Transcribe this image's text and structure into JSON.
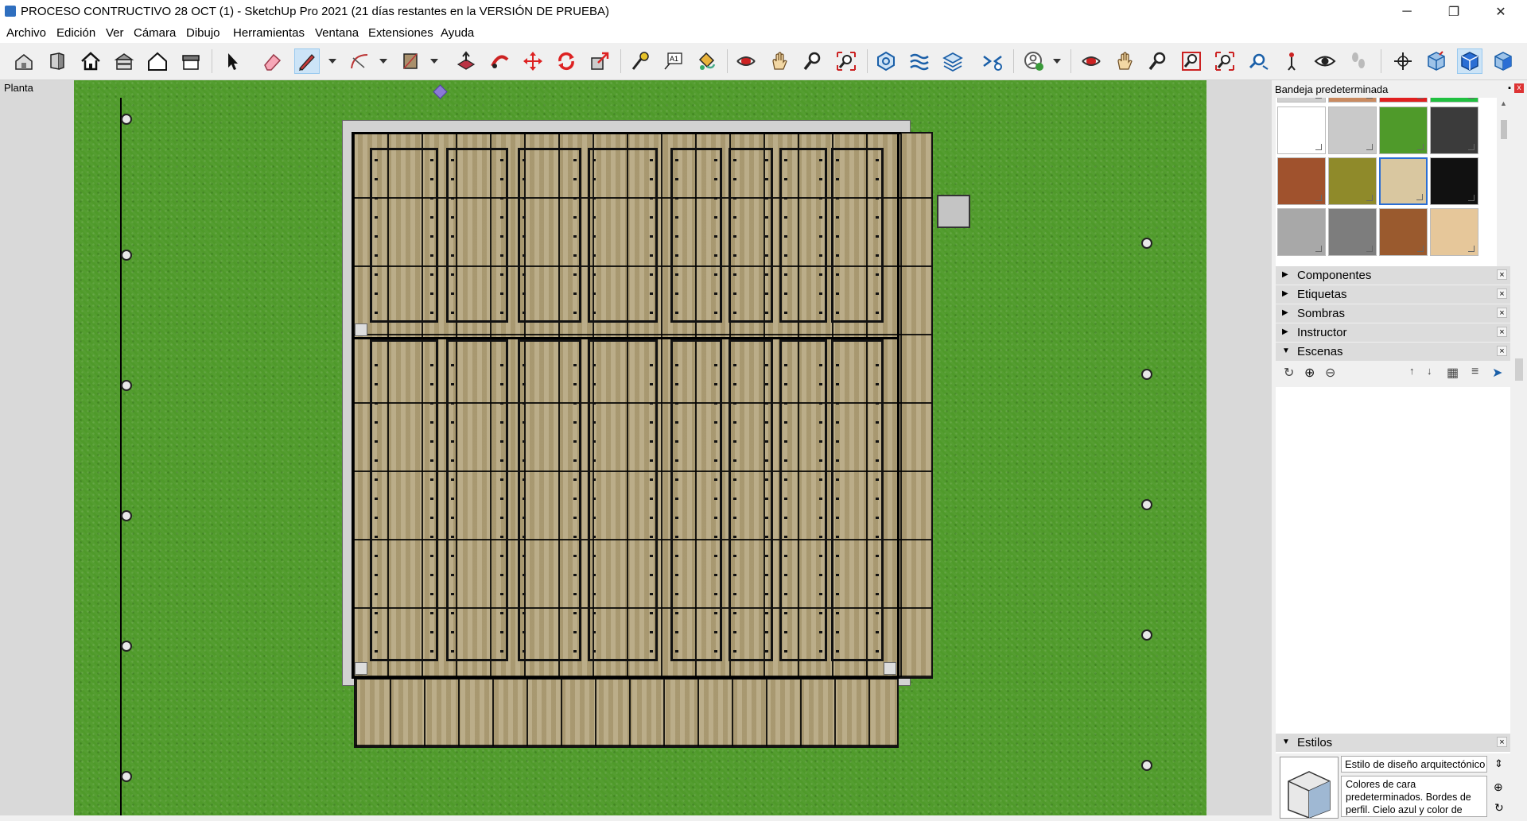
{
  "window": {
    "title": "PROCESO CONTRUCTIVO 28 OCT (1) - SketchUp Pro 2021 (21 días restantes en la VERSIÓN DE PRUEBA)",
    "minimize": "─",
    "maximize": "❐",
    "close": "✕"
  },
  "menu": [
    "Archivo",
    "Edición",
    "Ver",
    "Cámara",
    "Dibujo",
    "Herramientas",
    "Ventana",
    "Extensiones",
    "Ayuda"
  ],
  "toolbar": {
    "icons": [
      "house-iso-icon",
      "front-view-icon",
      "home-icon",
      "back-view-icon",
      "top-house-icon",
      "side-house-icon",
      "select-arrow-icon",
      "eraser-icon",
      "pencil-line-icon",
      "arc-icon",
      "rectangle-icon",
      "push-pull-icon",
      "follow-me-icon",
      "move-icon",
      "rotate-icon",
      "scale-icon",
      "tape-measure-icon",
      "text-icon",
      "paint-bucket-icon",
      "orbit-icon",
      "pan-icon",
      "zoom-icon",
      "zoom-extents-icon",
      "solid-tools-icon",
      "section-plane-icon",
      "layers-icon",
      "settings-icon",
      "user-account-icon",
      "orbit-2-icon",
      "pan-2-icon",
      "zoom-2-icon",
      "zoom-window-icon",
      "zoom-extents-2-icon",
      "previous-view-icon",
      "position-camera-icon",
      "look-around-icon",
      "walk-icon",
      "axes-icon",
      "iso-view-icon",
      "top-view-icon",
      "right-view-icon"
    ]
  },
  "viewport": {
    "scene_label": "Planta"
  },
  "tray": {
    "title": "Bandeja predeterminada",
    "pin": "▪",
    "close": "x",
    "swatch_colors": [
      "#ffffff",
      "#c9c9c9",
      "#4f9a2a",
      "#3b3b3b",
      "#a0522d",
      "#8f8a2a",
      "#d9c7a0",
      "#111111",
      "#a8a8a8",
      "#7d7d7d",
      "#9a5a2e",
      "#e6c79a"
    ],
    "selected_swatch": 6
  },
  "panels": {
    "componentes": "Componentes",
    "etiquetas": "Etiquetas",
    "sombras": "Sombras",
    "instructor": "Instructor",
    "escenas": "Escenas",
    "estilos": "Estilos"
  },
  "scenes_toolbar": {
    "refresh": "↻",
    "add": "⊕",
    "remove": "⊖",
    "move_up": "↑",
    "move_down": "↓",
    "view_options": "▦",
    "details": "≡",
    "next": "➤"
  },
  "styles": {
    "name": "Estilo de diseño arquitectónico",
    "description": "Colores de cara predeterminados. Bordes de perfil. Cielo azul y color de"
  },
  "colors": {
    "grass": "#4f9a2a",
    "wood_deck": "#b3a47c",
    "selection_blue": "#2a6ed4"
  }
}
